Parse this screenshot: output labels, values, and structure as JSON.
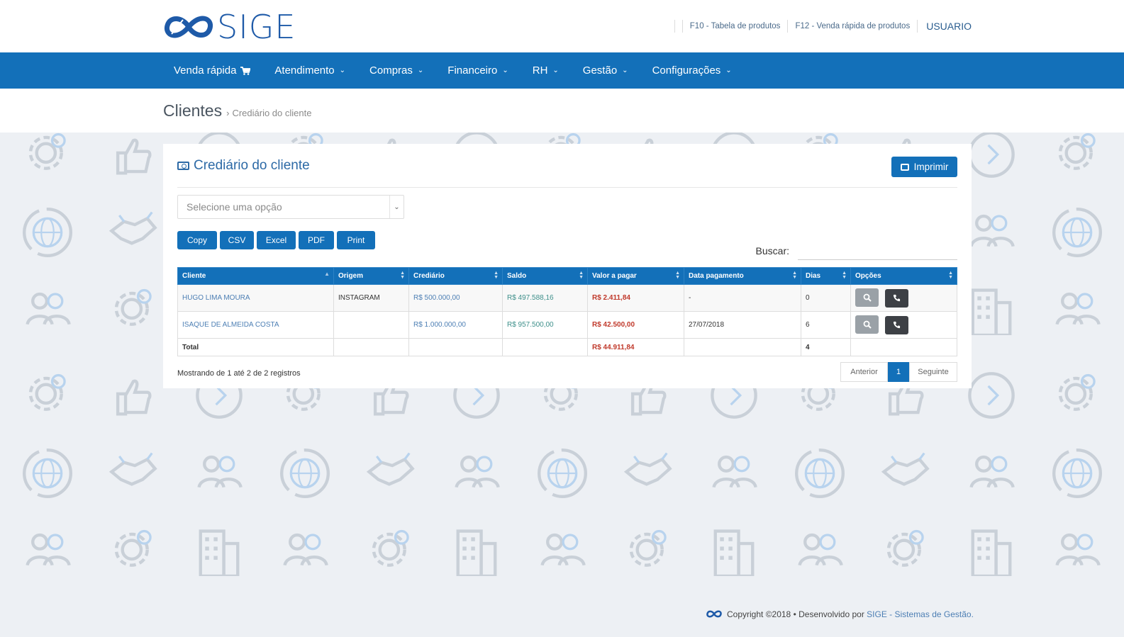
{
  "brand": {
    "name": "SIGE"
  },
  "top_links": {
    "f10": "F10 - Tabela de produtos",
    "f12": "F12 - Venda rápida de produtos",
    "user": "USUARIO"
  },
  "nav": [
    {
      "label": "Venda rápida",
      "icon": "cart-icon"
    },
    {
      "label": "Atendimento",
      "icon": "chevron-down-icon"
    },
    {
      "label": "Compras",
      "icon": "chevron-down-icon"
    },
    {
      "label": "Financeiro",
      "icon": "chevron-down-icon"
    },
    {
      "label": "RH",
      "icon": "chevron-down-icon"
    },
    {
      "label": "Gestão",
      "icon": "chevron-down-icon"
    },
    {
      "label": "Configurações",
      "icon": "chevron-down-icon"
    }
  ],
  "breadcrumb": {
    "title": "Clientes",
    "separator": "›",
    "current": "Crediário do cliente"
  },
  "panel": {
    "title": "Crediário do cliente",
    "print_label": "Imprimir",
    "select_placeholder": "Selecione uma opção",
    "export_buttons": [
      "Copy",
      "CSV",
      "Excel",
      "PDF",
      "Print"
    ],
    "search_label": "Buscar:",
    "search_value": ""
  },
  "table": {
    "columns": [
      "Cliente",
      "Origem",
      "Crediário",
      "Saldo",
      "Valor a pagar",
      "Data pagamento",
      "Dias",
      "Opções"
    ],
    "rows": [
      {
        "cliente": "HUGO LIMA MOURA",
        "origem": "INSTAGRAM",
        "crediario": "R$ 500.000,00",
        "saldo": "R$ 497.588,16",
        "valor": "R$ 2.411,84",
        "data": "-",
        "dias": "0"
      },
      {
        "cliente": "ISAQUE DE ALMEIDA COSTA",
        "origem": "",
        "crediario": "R$ 1.000.000,00",
        "saldo": "R$ 957.500,00",
        "valor": "R$ 42.500,00",
        "data": "27/07/2018",
        "dias": "6"
      }
    ],
    "total": {
      "label": "Total",
      "valor": "R$ 44.911,84",
      "dias": "4"
    }
  },
  "info_text": "Mostrando de 1 até 2 de 2 registros",
  "pager": {
    "prev": "Anterior",
    "page": "1",
    "next": "Seguinte"
  },
  "footer": {
    "text": "Copyright ©2018 • Desenvolvido por",
    "link": "SIGE - Sistemas de Gestão."
  },
  "colors": {
    "primary": "#1370b9",
    "negative": "#c0392b",
    "positive": "#3d8f8a",
    "link": "#4d7fb4"
  }
}
